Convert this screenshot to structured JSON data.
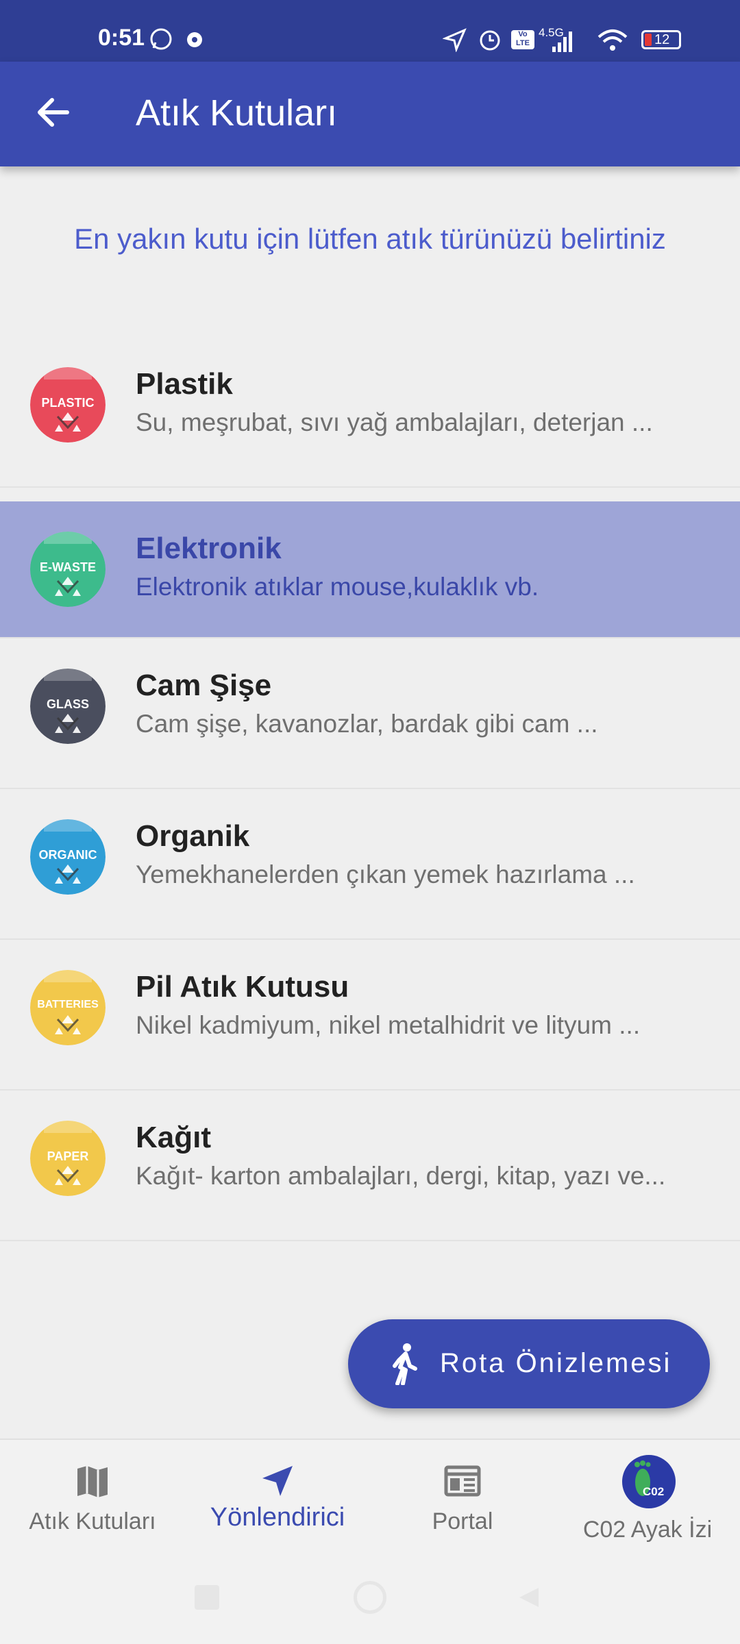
{
  "status_bar": {
    "time": "0:51",
    "network": "4.5G",
    "volte": "Vo LTE",
    "battery": "12"
  },
  "app_bar": {
    "title": "Atık Kutuları"
  },
  "subtitle": "En yakın kutu için lütfen atık türünüzü belirtiniz",
  "items": [
    {
      "name": "Plastik",
      "desc": "Su, meşrubat, sıvı yağ ambalajları, deterjan ...",
      "badge": "PLASTIC",
      "color": "#e84a5a",
      "selected": false
    },
    {
      "name": "Elektronik",
      "desc": "Elektronik atıklar mouse,kulaklık vb.",
      "badge": "E-WASTE",
      "color": "#3dbb8c",
      "selected": true
    },
    {
      "name": "Cam Şişe",
      "desc": "Cam şişe, kavanozlar, bardak gibi cam ...",
      "badge": "GLASS",
      "color": "#4a4e5e",
      "selected": false
    },
    {
      "name": "Organik",
      "desc": "Yemekhanelerden çıkan yemek hazırlama ...",
      "badge": "ORGANIC",
      "color": "#2f9ed6",
      "selected": false
    },
    {
      "name": "Pil Atık Kutusu",
      "desc": "Nikel kadmiyum, nikel metalhidrit ve lityum ...",
      "badge": "BATTERIES",
      "color": "#f2c84b",
      "selected": false
    },
    {
      "name": "Kağıt",
      "desc": "Kağıt- karton ambalajları, dergi, kitap, yazı ve...",
      "badge": "PAPER",
      "color": "#f2c84b",
      "selected": false
    }
  ],
  "fab": {
    "label": "Rota Önizlemesi"
  },
  "bottom_nav": [
    {
      "label": "Atık Kutuları",
      "icon": "map-icon",
      "active": false
    },
    {
      "label": "Yönlendirici",
      "icon": "navigation-arrow-icon",
      "active": true
    },
    {
      "label": "Portal",
      "icon": "newspaper-icon",
      "active": false
    },
    {
      "label": "C02 Ayak İzi",
      "icon": "footprint-icon",
      "active": false,
      "badge": "C02"
    }
  ],
  "colors": {
    "primary": "#3b4bb0",
    "status_bar": "#2f3e94",
    "accent_text": "#4c5ccc",
    "selected_row": "#9ea5d7"
  }
}
